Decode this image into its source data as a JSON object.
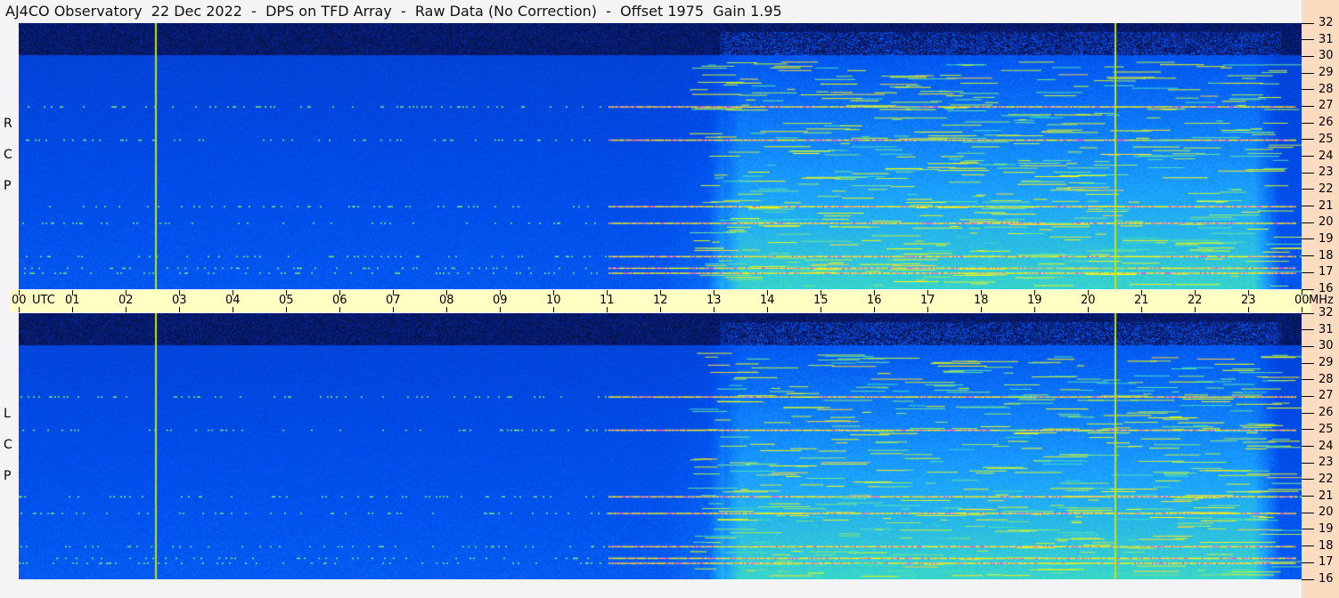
{
  "title": "AJ4CO Observatory  22 Dec 2022  -  DPS on TFD Array  -  Raw Data (No Correction)  -  Offset 1975  Gain 1.95",
  "chart_data": {
    "type": "heatmap",
    "title": "AJ4CO Observatory  22 Dec 2022  -  DPS on TFD Array  -  Raw Data (No Correction)  -  Offset 1975  Gain 1.95",
    "x_unit_label": "UTC",
    "y_unit_label": "MHz",
    "x_ticks": [
      "00",
      "01",
      "02",
      "03",
      "04",
      "05",
      "06",
      "07",
      "08",
      "09",
      "10",
      "11",
      "12",
      "13",
      "14",
      "15",
      "16",
      "17",
      "18",
      "19",
      "20",
      "21",
      "22",
      "23",
      "00"
    ],
    "y_ticks": [
      "32",
      "31",
      "30",
      "29",
      "28",
      "27",
      "26",
      "25",
      "24",
      "23",
      "22",
      "21",
      "20",
      "19",
      "18",
      "17",
      "16"
    ],
    "xlim_hours": [
      0,
      24
    ],
    "ylim_mhz": [
      16,
      32
    ],
    "panels": [
      {
        "name": "R C P",
        "letters": [
          "R",
          "C",
          "P"
        ]
      },
      {
        "name": "L C P",
        "letters": [
          "L",
          "C",
          "P"
        ]
      }
    ],
    "colormap": [
      "#000000",
      "#0a2aa8",
      "#0050f0",
      "#1aa0ff",
      "#40e0c0",
      "#c0f040",
      "#ffff00",
      "#ff40ff"
    ],
    "marker_lines_utc": [
      2.55,
      20.5
    ],
    "marker_color": "#c8e000",
    "persistent_signals_mhz": [
      17.0,
      17.3,
      18.0,
      20.0,
      21.0,
      25.0,
      27.0
    ],
    "features": {
      "no_data_above_mhz": 30.1,
      "daytime_enhancement_utc": [
        12.9,
        23.6
      ]
    }
  }
}
